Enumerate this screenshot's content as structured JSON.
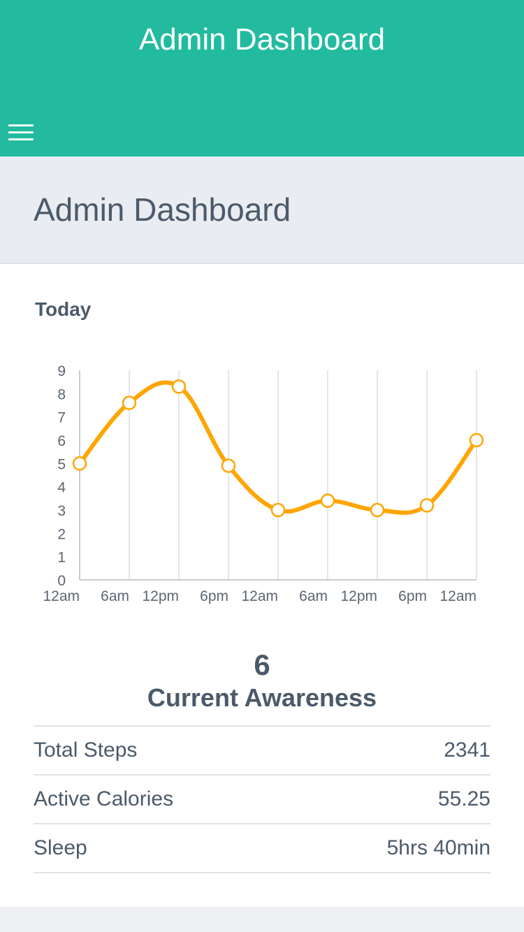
{
  "app": {
    "title": "Admin Dashboard",
    "menu_icon": "hamburger-menu-icon",
    "accent_color": "#22bb9f"
  },
  "page": {
    "title": "Admin Dashboard"
  },
  "card": {
    "title": "Today"
  },
  "chart_data": {
    "type": "line",
    "x": [
      "12am",
      "6am",
      "12pm",
      "6pm",
      "12am",
      "6am",
      "12pm",
      "6pm",
      "12am"
    ],
    "series": [
      {
        "values": [
          5,
          7.6,
          8.3,
          4.9,
          3.0,
          3.4,
          3.0,
          3.2,
          6.0
        ],
        "color": "#ffa500"
      }
    ],
    "ylim": [
      0,
      9
    ],
    "yticks": [
      0,
      1,
      2,
      3,
      4,
      5,
      6,
      7,
      8,
      9
    ],
    "grid": "vertical",
    "title": "",
    "xlabel": "",
    "ylabel": ""
  },
  "metric": {
    "value": "6",
    "label": "Current Awareness"
  },
  "stats": [
    {
      "label": "Total Steps",
      "value": "2341"
    },
    {
      "label": "Active Calories",
      "value": "55.25"
    },
    {
      "label": "Sleep",
      "value": "5hrs 40min"
    }
  ]
}
